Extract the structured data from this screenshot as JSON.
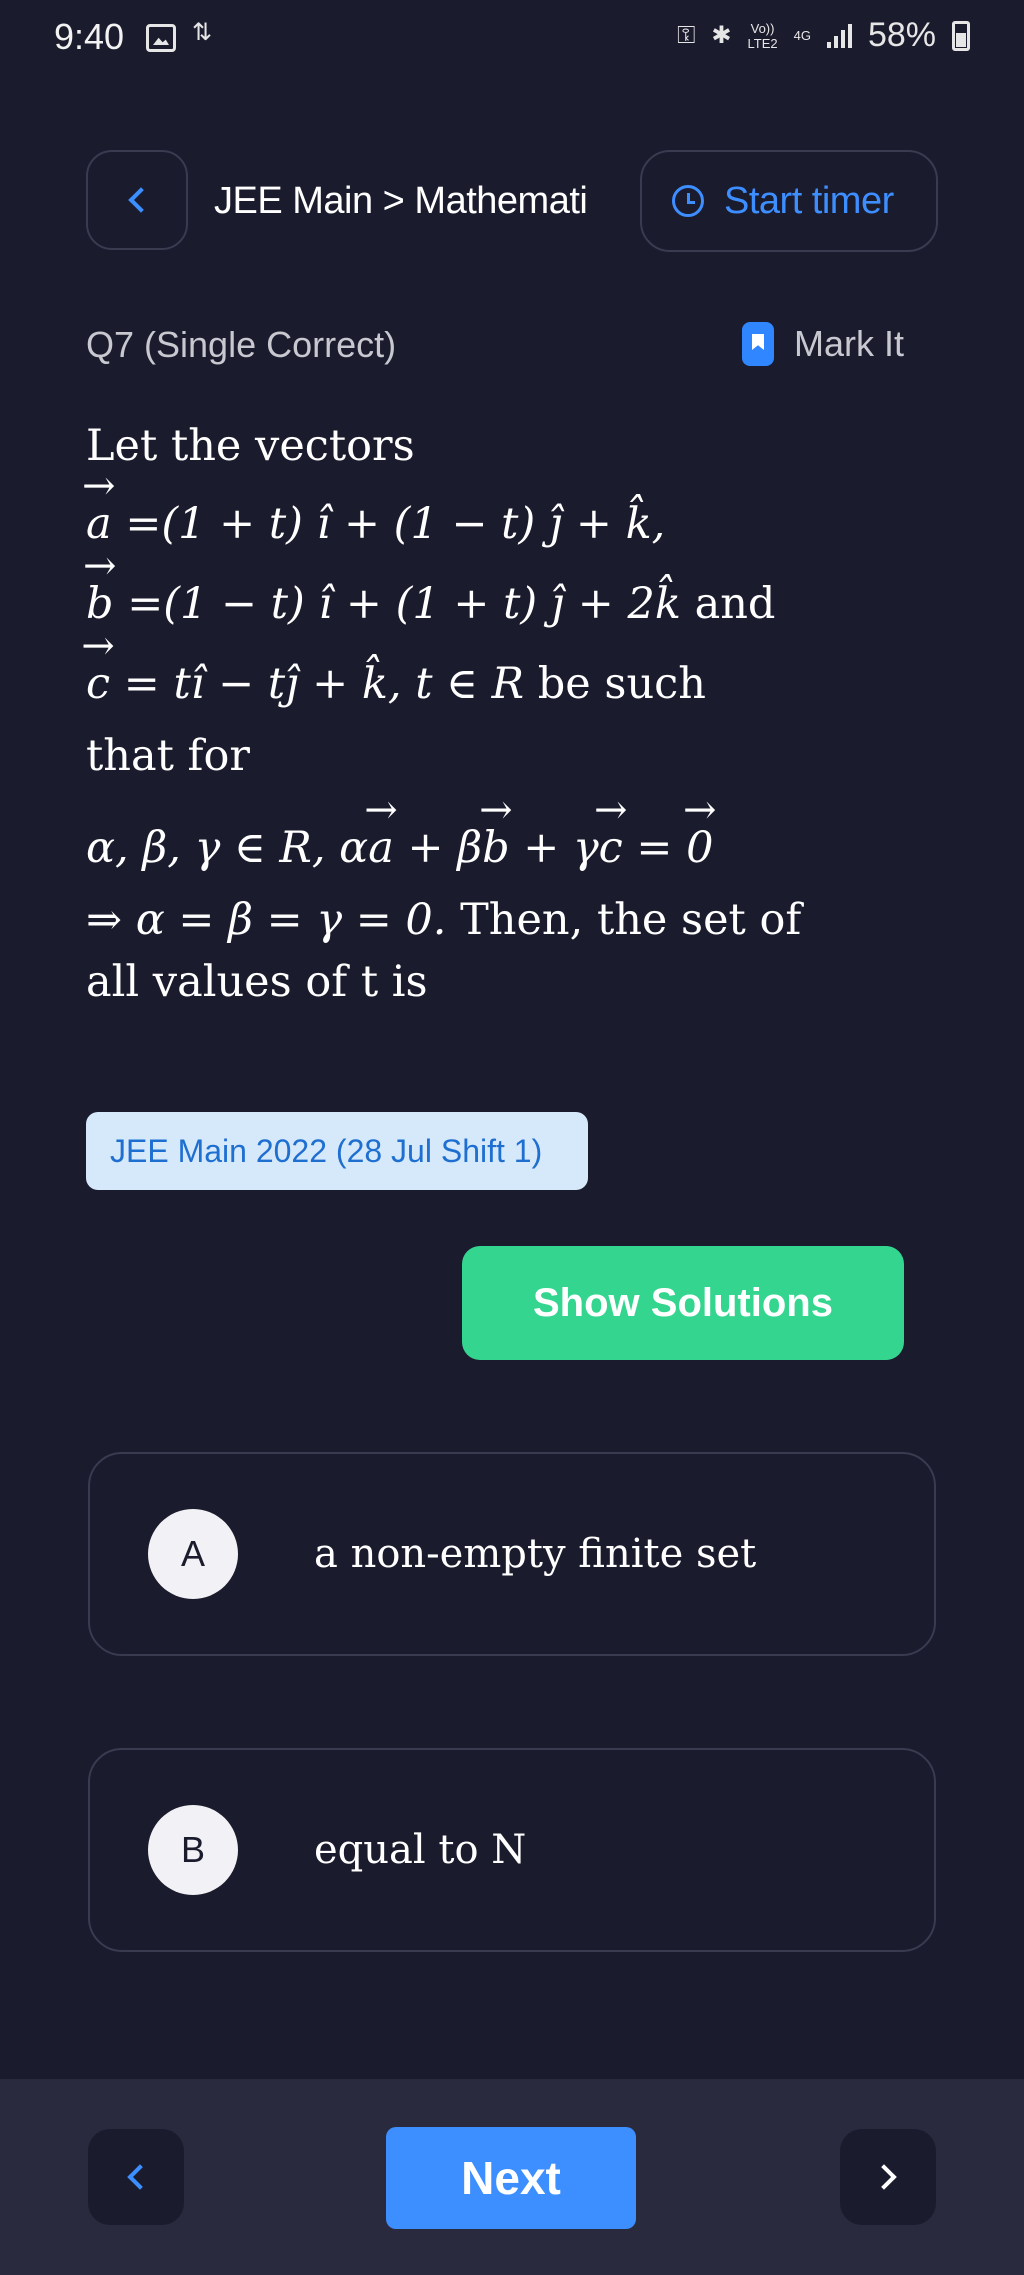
{
  "status_bar": {
    "time": "9:40",
    "network_top": "Vo))",
    "network_bottom": "LTE2",
    "network_type": "4G",
    "battery": "58%"
  },
  "header": {
    "breadcrumb": "JEE Main > Mathemati",
    "start_timer_label": "Start timer"
  },
  "question": {
    "label": "Q7 (Single Correct)",
    "mark_label": "Mark It",
    "intro": "Let the vectors",
    "a_rhs": "=(1 + t) î + (1 − t) ĵ + k̂,",
    "b_rhs": "=(1 − t) î + (1 + t) ĵ + 2k̂",
    "and_word": "and",
    "c_rhs": "= tî − tĵ + k̂, t ∈ R",
    "be_such": "be such",
    "that_for": "that for",
    "condition_prefix": "α, β, γ ∈ R, α",
    "condition_plus_beta": " + β",
    "condition_plus_gamma": " + γ",
    "condition_eq": " = ",
    "implies": "⇒ α = β = γ = 0.",
    "then_text": " Then, the set of",
    "final": "all values of t is",
    "vec_a": "a",
    "vec_b": "b",
    "vec_c": "c",
    "vec_zero": "0"
  },
  "source_tag": "JEE Main 2022 (28 Jul Shift 1)",
  "show_solutions_label": "Show Solutions",
  "options": [
    {
      "letter": "A",
      "text": "a non-empty finite set"
    },
    {
      "letter": "B",
      "text": "equal to N"
    }
  ],
  "bottom_nav": {
    "next_label": "Next"
  },
  "colors": {
    "background": "#1b1b2e",
    "accent_blue": "#3d8eff",
    "accent_green": "#34d58f",
    "tag_background": "#d6e9fb"
  }
}
